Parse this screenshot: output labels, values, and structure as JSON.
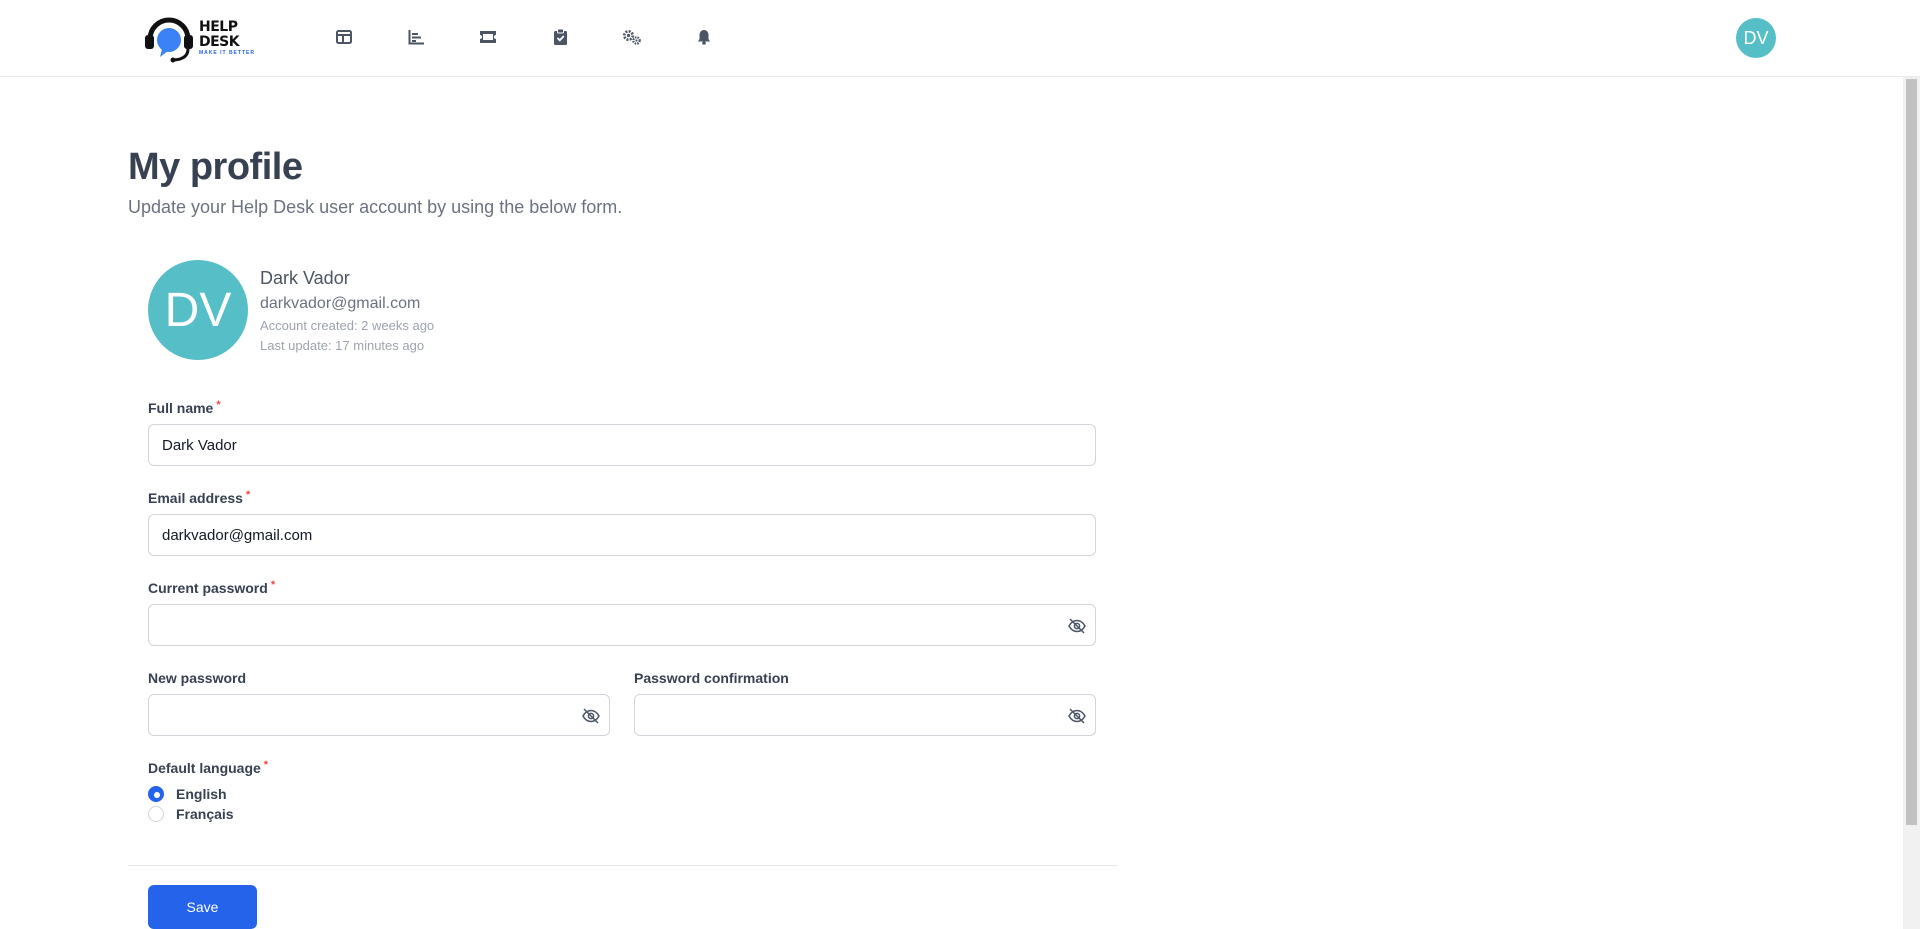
{
  "brand": {
    "title": "HELP DESK",
    "tagline": "MAKE IT BETTER"
  },
  "nav": {
    "icons": [
      "dashboard-icon",
      "chart-icon",
      "ticket-icon",
      "clipboard-check-icon",
      "settings-gears-icon",
      "bell-icon"
    ]
  },
  "user": {
    "initials": "DV"
  },
  "page": {
    "title": "My profile",
    "subtitle": "Update your Help Desk user account by using the below form."
  },
  "profile": {
    "initials": "DV",
    "name": "Dark Vador",
    "email": "darkvador@gmail.com",
    "created": "Account created: 2 weeks ago",
    "updated": "Last update: 17 minutes ago"
  },
  "form": {
    "full_name": {
      "label": "Full name",
      "value": "Dark Vador",
      "required": "*"
    },
    "email": {
      "label": "Email address",
      "value": "darkvador@gmail.com",
      "required": "*"
    },
    "current_password": {
      "label": "Current password",
      "value": "",
      "required": "*"
    },
    "new_password": {
      "label": "New password",
      "value": ""
    },
    "password_confirmation": {
      "label": "Password confirmation",
      "value": ""
    },
    "language": {
      "label": "Default language",
      "required": "*",
      "options": [
        {
          "label": "English",
          "selected": true
        },
        {
          "label": "Français",
          "selected": false
        }
      ]
    },
    "save_label": "Save"
  },
  "colors": {
    "accent": "#2563eb",
    "avatar": "#56bec6",
    "required": "#ef4444"
  }
}
